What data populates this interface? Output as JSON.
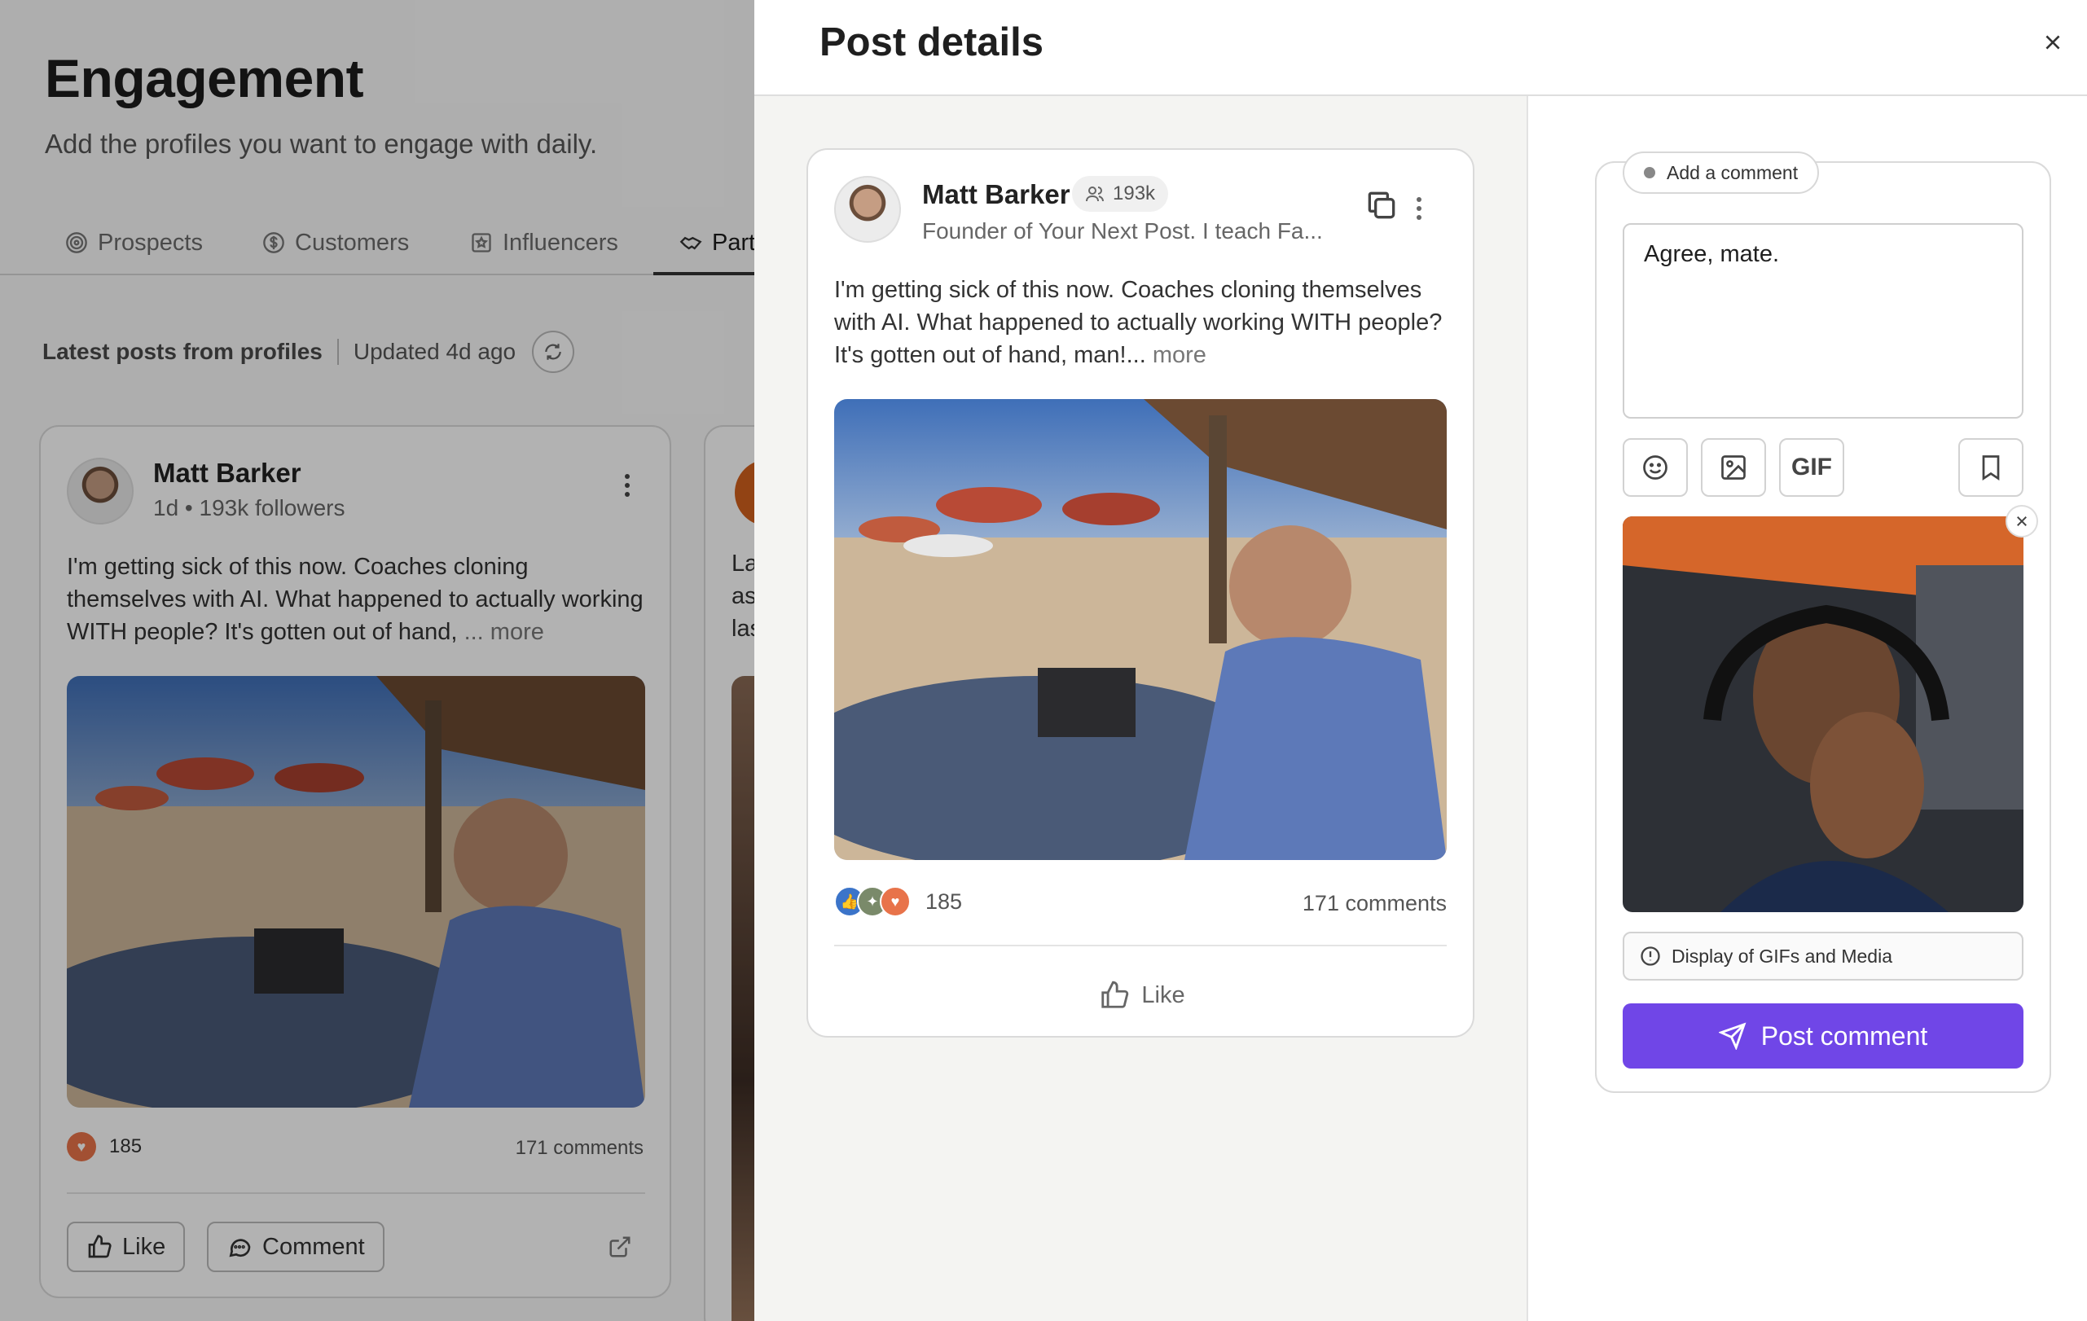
{
  "background": {
    "title": "Engagement",
    "subtitle": "Add the profiles you want to engage with daily.",
    "tabs": [
      {
        "label": "Prospects",
        "icon": "target-icon"
      },
      {
        "label": "Customers",
        "icon": "dollar-icon"
      },
      {
        "label": "Influencers",
        "icon": "star-icon"
      },
      {
        "label": "Part",
        "icon": "handshake-icon",
        "active": true
      }
    ],
    "latest_label": "Latest posts from profiles",
    "updated": "Updated 4d ago",
    "card": {
      "name": "Matt Barker",
      "meta": "1d • 193k followers",
      "text": "I'm getting sick of this now. Coaches cloning themselves with AI. What happened to actually working WITH people? It's gotten out of hand,",
      "more": "... more",
      "reactions": "185",
      "comments": "171 comments",
      "like": "Like",
      "comment": "Comment"
    },
    "card2_snippets": [
      "La",
      "as",
      "las"
    ]
  },
  "drawer": {
    "title": "Post details",
    "post": {
      "name": "Matt Barker",
      "followers": "193k",
      "headline": "Founder of Your Next Post. I teach Fa...",
      "text": "I'm getting sick of this now. Coaches cloning themselves with AI. What happened to actually working WITH people? It's gotten out of hand, man!...",
      "more": " more",
      "reactions": "185",
      "comments": "171 comments",
      "like": "Like"
    },
    "comment": {
      "tab_label": "Add a comment",
      "value": "Agree, mate.",
      "gif_label": "GIF",
      "notice": "Display of GIFs and Media",
      "submit": "Post comment"
    }
  },
  "colors": {
    "accent": "#7046e7",
    "overlay": "rgba(0,0,0,0.30)"
  }
}
